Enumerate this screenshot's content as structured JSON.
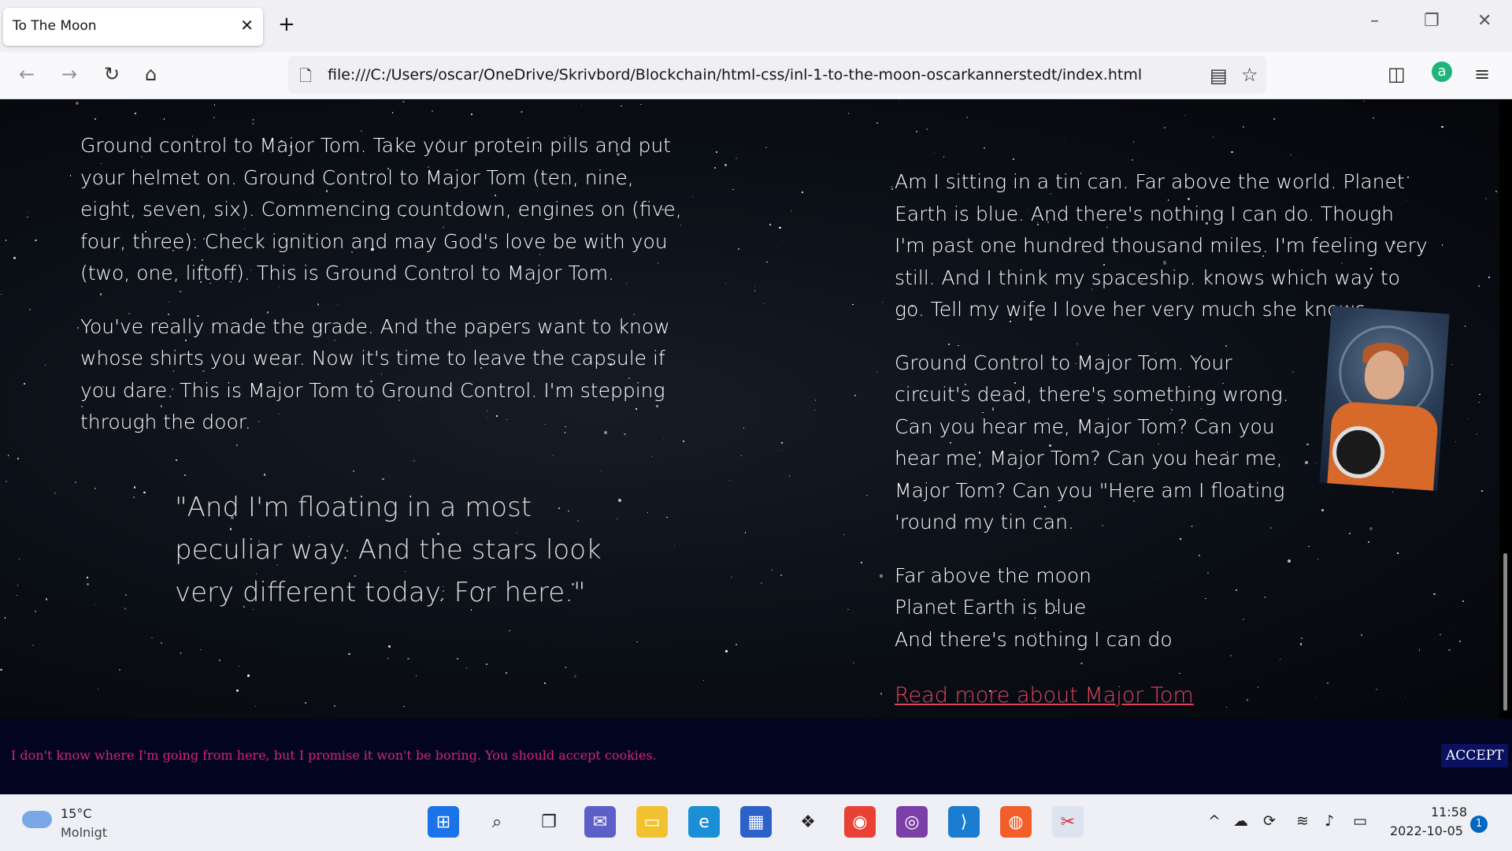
{
  "browser": {
    "tab_title": "To The Moon",
    "tab_close": "✕",
    "new_tab": "+",
    "url": "file:///C:/Users/oscar/OneDrive/Skrivbord/Blockchain/html-css/inl-1-to-the-moon-oscarkannerstedt/index.html"
  },
  "content": {
    "left_paragraphs": [
      "Ground control to Major Tom. Take your protein pills and put your helmet on. Ground Control to Major Tom (ten, nine, eight, seven, six). Commencing countdown, engines on (five, four, three). Check ignition and may God's love be with you (two, one, liftoff). This is Ground Control to Major Tom.",
      "You've really made the grade. And the papers want to know whose shirts you wear. Now it's time to leave the capsule if you dare. This is Major Tom to Ground Control. I'm stepping through the door."
    ],
    "quote": "\"And I'm floating in a most peculiar way. And the stars look very different today. For here.\"",
    "right_paragraphs": [
      "Am I sitting in a tin can. Far above the world. Planet Earth is blue. And there's nothing I can do. Though I'm past one hundred thousand miles. I'm feeling very still. And I think my spaceship. knows which way to go. Tell my wife I love her very much she knows.",
      "Ground Control to Major Tom. Your circuit's dead, there's something wrong. Can you hear me, Major Tom? Can you hear me, Major Tom? Can you hear me, Major Tom? Can you \"Here am I floating 'round my tin can."
    ],
    "lines": [
      "Far above the moon",
      "Planet Earth is blue",
      "And there's nothing I can do"
    ],
    "read_more": "Read more about Major Tom"
  },
  "cookie": {
    "text": "I don't know where I'm going from here, but I promise it won't be boring. You should accept cookies.",
    "button": "ACCEPT"
  },
  "taskbar": {
    "weather_temp": "15°C",
    "weather_desc": "Molnigt",
    "time": "11:58",
    "date": "2022-10-05",
    "notifications": "1"
  }
}
